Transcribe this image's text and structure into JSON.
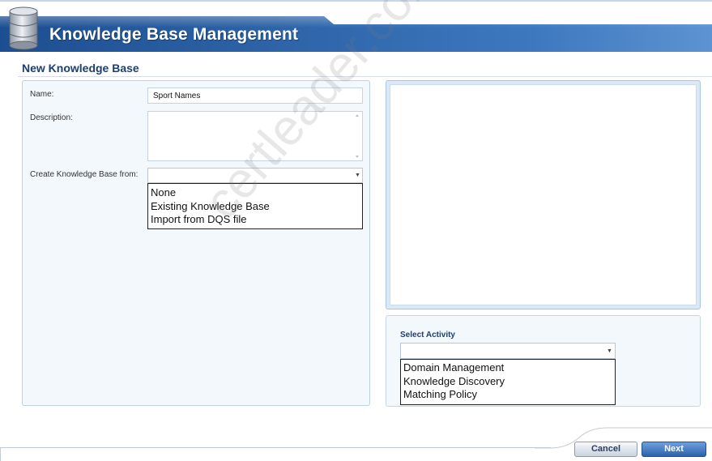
{
  "header": {
    "title": "Knowledge Base Management"
  },
  "section_title": "New Knowledge Base",
  "form": {
    "name_label": "Name:",
    "name_value": "Sport Names",
    "description_label": "Description:",
    "description_value": "",
    "create_from_label": "Create Knowledge Base from:",
    "create_from_selected": "",
    "create_from_options": [
      "None",
      "Existing Knowledge Base",
      "Import from DQS file"
    ]
  },
  "activity": {
    "label": "Select Activity",
    "selected": "",
    "options": [
      "Domain Management",
      "Knowledge Discovery",
      "Matching Policy"
    ]
  },
  "buttons": {
    "cancel": "Cancel",
    "next": "Next"
  },
  "watermark": "certleader.com",
  "colors": {
    "header_band": "#2e64a8",
    "title_text": "#1d3e6e",
    "panel_bg": "#f3f8fd",
    "next_button": "#2c61ad"
  }
}
